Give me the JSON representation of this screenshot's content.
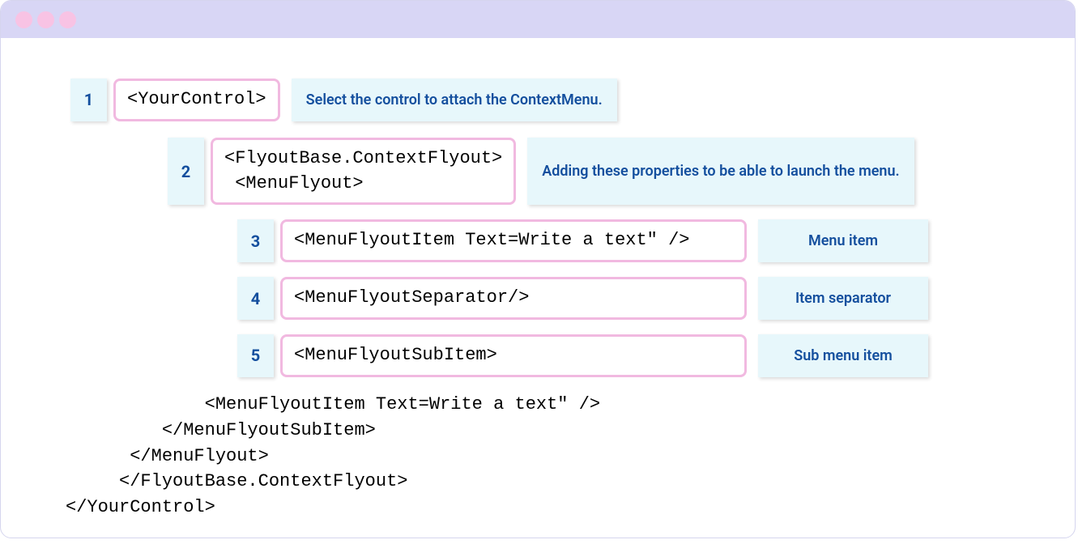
{
  "rows": [
    {
      "num": "1",
      "code": "<YourControl>",
      "hint": "Select the control to attach the ContextMenu."
    },
    {
      "num": "2",
      "code": "<FlyoutBase.ContextFlyout>\n <MenuFlyout>",
      "hint": "Adding these properties to be able to launch the menu."
    },
    {
      "num": "3",
      "code": "<MenuFlyoutItem Text=Write a text\" />",
      "hint": "Menu item"
    },
    {
      "num": "4",
      "code": "<MenuFlyoutSeparator/>",
      "hint": "Item separator"
    },
    {
      "num": "5",
      "code": "<MenuFlyoutSubItem>",
      "hint": "Sub menu item"
    }
  ],
  "tail_code": "             <MenuFlyoutItem Text=Write a text\" />\n         </MenuFlyoutSubItem>\n      </MenuFlyout>\n     </FlyoutBase.ContextFlyout>\n</YourControl>"
}
